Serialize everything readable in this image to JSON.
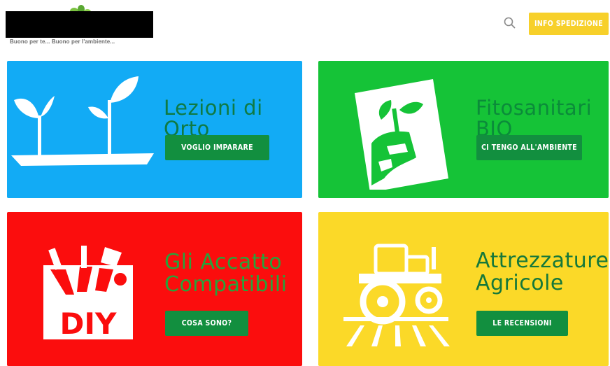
{
  "header": {
    "tagline": "Buono per te... Buono per l'ambiente...",
    "search_icon": "search-icon",
    "shipping_button_label": "INFO SPEDIZIONE"
  },
  "cards": [
    {
      "id": "lezioni",
      "title": "Lezioni di Orto",
      "button_label": "VOGLIO IMPARARE",
      "color": "#12abf5",
      "icon": "sprouts-icon"
    },
    {
      "id": "fitosanitari",
      "title": "Fitosanitari BIO",
      "button_label": "CI TENGO ALL'AMBIENTE",
      "color": "#15c337",
      "icon": "sprout-in-hand-icon"
    },
    {
      "id": "accatto",
      "title": "Gli Accatto Compatibili",
      "button_label": "COSA SONO?",
      "color": "#fb0d0d",
      "icon": "diy-tools-icon"
    },
    {
      "id": "attrezzature",
      "title": "Attrezzature Agricole",
      "button_label": "LE RECENSIONI",
      "color": "#fbd928",
      "icon": "tractor-icon"
    }
  ],
  "colors": {
    "accent_yellow": "#f7d02a",
    "button_green": "#128f3f",
    "title_green": "#15783a"
  }
}
